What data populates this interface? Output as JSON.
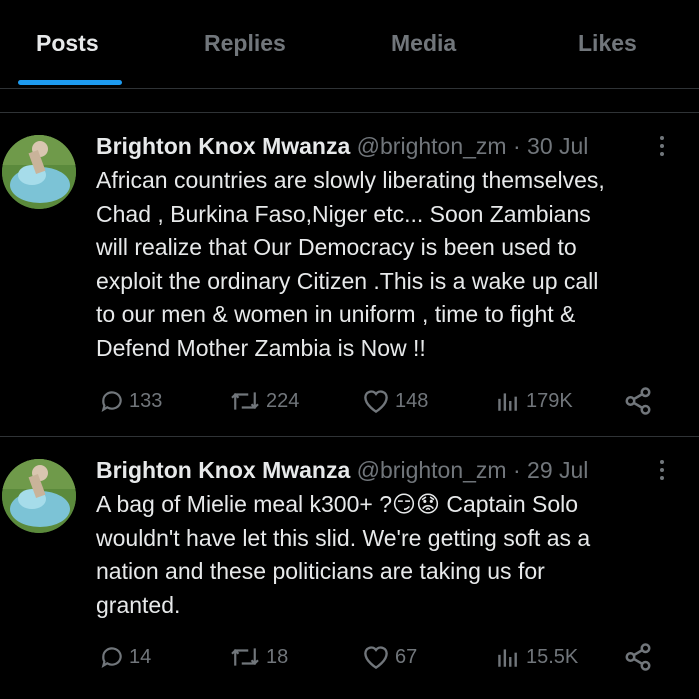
{
  "tabs": [
    {
      "label": "Posts",
      "active": true
    },
    {
      "label": "Replies",
      "active": false
    },
    {
      "label": "Media",
      "active": false
    },
    {
      "label": "Likes",
      "active": false
    }
  ],
  "tweets": [
    {
      "name": "Brighton Knox Mwanza",
      "handle": "@brighton_zm",
      "dot": "·",
      "date": "30 Jul",
      "text": "African countries are slowly liberating themselves,\nChad , Burkina Faso,Niger etc... Soon Zambians\nwill realize that Our Democracy is been used to\nexploit the ordinary Citizen .This is a wake up  call\nto our men & women in uniform , time to fight &\nDefend Mother Zambia is Now !!",
      "replies": "133",
      "reposts": "224",
      "likes": "148",
      "views": "179K"
    },
    {
      "name": "Brighton Knox Mwanza",
      "handle": "@brighton_zm",
      "dot": "·",
      "date": "29 Jul",
      "text": "A bag of Mielie meal k300+ ?😏😟 Captain Solo\nwouldn't have let this slid. We're getting soft as a\nnation and these politicians are taking us for\ngranted.",
      "replies": "14",
      "reposts": "18",
      "likes": "67",
      "views": "15.5K"
    }
  ],
  "colors": {
    "accent": "#1d9bf0",
    "background": "#000000",
    "muted": "#71767b",
    "text": "#e7e9ea"
  }
}
